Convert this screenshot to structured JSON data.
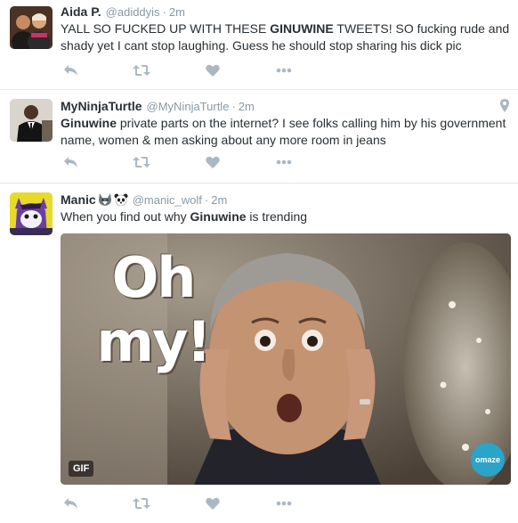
{
  "tweets": [
    {
      "fullname": "Aida P.",
      "username": "@adiddyis",
      "time": "2m",
      "text_before": "YALL SO FUCKED UP WITH THESE ",
      "text_bold": "GINUWINE",
      "text_after": " TWEETS! SO fucking rude and shady yet I cant stop laughing. Guess he should stop sharing his dick pic"
    },
    {
      "fullname": "MyNinjaTurtle",
      "username": "@MyNinjaTurtle",
      "time": "2m",
      "text_before": "",
      "text_bold": "Ginuwine",
      "text_after": " private parts on the internet? I see folks calling him by his government name, women & men asking about any more room in jeans"
    },
    {
      "fullname": "Manic",
      "username": "@manic_wolf",
      "time": "2m",
      "text_before": "When you find out why ",
      "text_bold": "Ginuwine",
      "text_after": " is trending",
      "media": {
        "caption_line1": "Oh",
        "caption_line2": "my!",
        "badge": "GIF",
        "watermark": "omaze"
      }
    }
  ],
  "separator": "·",
  "icons": {
    "reply": "reply-icon",
    "retweet": "retweet-icon",
    "like": "heart-icon",
    "more": "more-dots-icon",
    "location": "location-pin-icon"
  },
  "colors": {
    "text": "#292f33",
    "muted": "#8899a6",
    "action": "#aab8c2",
    "border": "#e1e8ed"
  }
}
